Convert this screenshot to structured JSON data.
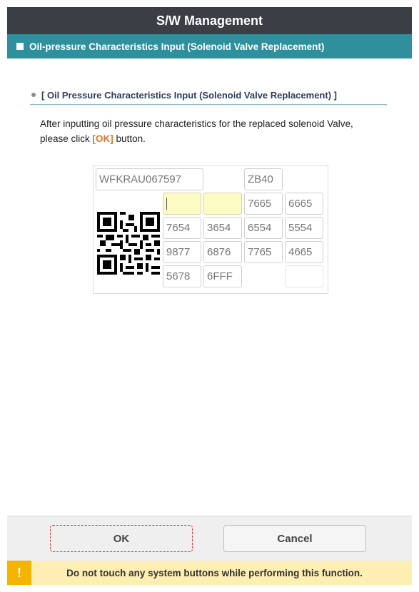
{
  "window": {
    "title": "S/W Management",
    "subtitle": "Oil-pressure Characteristics Input (Solenoid Valve Replacement)"
  },
  "section": {
    "heading": "[ Oil Pressure Characteristics Input (Solenoid Valve Replacement) ]",
    "instruction_line1": "After inputting oil pressure characteristics for the replaced solenoid Valve,",
    "instruction_pre": "please click ",
    "instruction_ok": "[OK]",
    "instruction_post": " button."
  },
  "grid": {
    "serial": "WFKRAU067597",
    "code": "ZB40",
    "rows": [
      [
        "",
        "",
        "7665",
        "6665"
      ],
      [
        "7654",
        "3654",
        "6554",
        "5554"
      ],
      [
        "9877",
        "6876",
        "7765",
        "4665"
      ],
      [
        "5678",
        "6FFF",
        "",
        ""
      ]
    ]
  },
  "buttons": {
    "ok": "OK",
    "cancel": "Cancel"
  },
  "warning": {
    "icon": "!",
    "text": "Do not touch any system buttons while performing this function."
  },
  "colors": {
    "titlebar": "#3b3e45",
    "subbar": "#2f8f9d",
    "input_highlight": "#fdfbc4",
    "ok_reference": "#e8742a",
    "warning_bg": "#fdeeb4",
    "warning_icon": "#f4b400"
  }
}
